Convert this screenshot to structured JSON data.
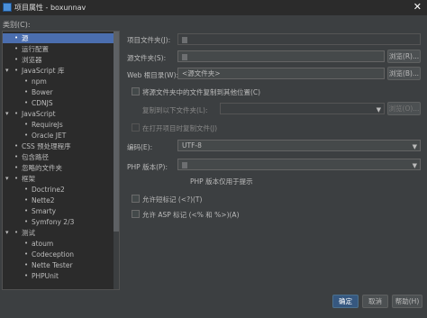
{
  "window": {
    "title": "项目属性 - boxunnav",
    "close": "✕"
  },
  "categories_label": "类别(C):",
  "tree": [
    {
      "label": "源",
      "level": 1,
      "toggle": "",
      "selected": true
    },
    {
      "label": "运行配置",
      "level": 1,
      "toggle": ""
    },
    {
      "label": "浏览器",
      "level": 1,
      "toggle": ""
    },
    {
      "label": "JavaScript 库",
      "level": 1,
      "toggle": "▾"
    },
    {
      "label": "npm",
      "level": 2,
      "toggle": ""
    },
    {
      "label": "Bower",
      "level": 2,
      "toggle": ""
    },
    {
      "label": "CDNJS",
      "level": 2,
      "toggle": ""
    },
    {
      "label": "JavaScript",
      "level": 1,
      "toggle": "▾"
    },
    {
      "label": "RequireJs",
      "level": 2,
      "toggle": ""
    },
    {
      "label": "Oracle JET",
      "level": 2,
      "toggle": ""
    },
    {
      "label": "CSS 预处理程序",
      "level": 1,
      "toggle": ""
    },
    {
      "label": "包含路径",
      "level": 1,
      "toggle": ""
    },
    {
      "label": "忽略的文件夹",
      "level": 1,
      "toggle": ""
    },
    {
      "label": "框架",
      "level": 1,
      "toggle": "▾"
    },
    {
      "label": "Doctrine2",
      "level": 2,
      "toggle": ""
    },
    {
      "label": "Nette2",
      "level": 2,
      "toggle": ""
    },
    {
      "label": "Smarty",
      "level": 2,
      "toggle": ""
    },
    {
      "label": "Symfony 2/3",
      "level": 2,
      "toggle": ""
    },
    {
      "label": "测试",
      "level": 1,
      "toggle": "▾"
    },
    {
      "label": "atoum",
      "level": 2,
      "toggle": ""
    },
    {
      "label": "Codeception",
      "level": 2,
      "toggle": ""
    },
    {
      "label": "Nette Tester",
      "level": 2,
      "toggle": ""
    },
    {
      "label": "PHPUnit",
      "level": 2,
      "toggle": ""
    }
  ],
  "form": {
    "project_folder_label": "项目文件夹(J):",
    "source_folder_label": "源文件夹(S):",
    "web_root_label": "Web 根目录(W):",
    "web_root_value": "<源文件夹>",
    "browse_label": "浏览(R)...",
    "browse_label_2": "浏览(B)...",
    "browse_label_3": "浏览(O)...",
    "copy_checkbox_label": "将源文件夹中的文件复制到其他位置(C)",
    "copy_to_label": "复制到以下文件夹(L):",
    "copy_on_open_label": "在打开项目时复制文件(J)",
    "encoding_label": "编码(E):",
    "encoding_value": "UTF-8",
    "php_version_label": "PHP 版本(P):",
    "php_hint": "PHP 版本仅用于提示",
    "short_tags_label": "允许短标记 (<?)(T)",
    "asp_tags_label": "允许 ASP 标记 (<% 和 %>)(A)",
    "dropdown_arrow": "▼"
  },
  "footer": {
    "ok": "确定",
    "cancel": "取消",
    "help": "帮助(H)"
  }
}
